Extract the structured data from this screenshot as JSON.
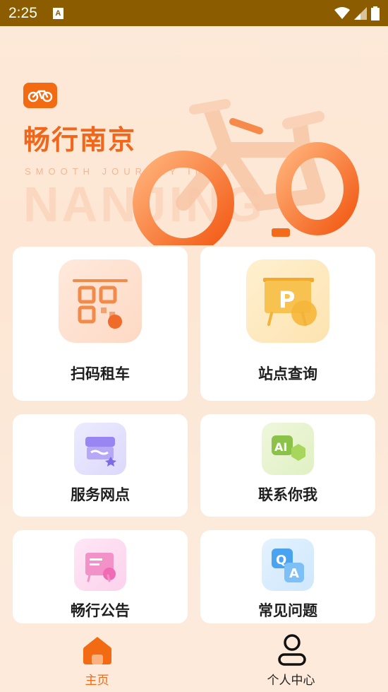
{
  "status_bar": {
    "time": "2:25",
    "notification_icon": "a-letter-icon",
    "icons": [
      "wifi-icon",
      "signal-icon",
      "battery-icon"
    ]
  },
  "hero": {
    "title": "畅行南京",
    "subtitle": "SMOOTH JOURNEY IN",
    "watermark": "NANJING",
    "logo_icon": "bike-logo-icon"
  },
  "cards": {
    "scan_rent": "扫码租车",
    "station_query": "站点查询",
    "service_outlets": "服务网点",
    "contact_us": "联系你我",
    "announcements": "畅行公告",
    "faq": "常见问题"
  },
  "nav": {
    "home": "主页",
    "profile": "个人中心"
  },
  "colors": {
    "accent": "#f26a12",
    "status_bar": "#8b5d00",
    "background": "#fde9d9"
  }
}
